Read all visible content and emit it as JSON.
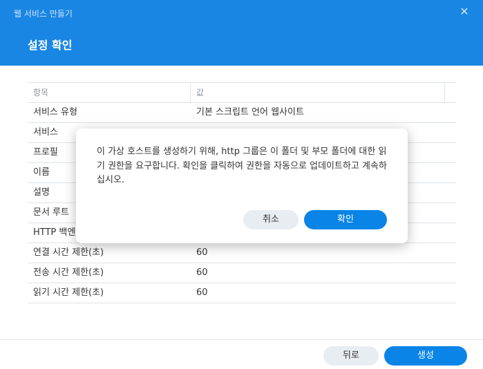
{
  "window": {
    "title": "웹 서비스 만들기",
    "close_icon": "✕",
    "page_title": "설정 확인"
  },
  "table": {
    "headers": [
      "항목",
      "값"
    ],
    "rows": [
      {
        "item": "서비스 유형",
        "value": "기본 스크립트 언어 웹사이트"
      },
      {
        "item": "서비스",
        "value": ""
      },
      {
        "item": "프로필",
        "value": ""
      },
      {
        "item": "이름",
        "value": ""
      },
      {
        "item": "설명",
        "value": ""
      },
      {
        "item": "문서 루트",
        "value": ""
      },
      {
        "item": "HTTP 백엔드",
        "value": ""
      },
      {
        "item": "연결 시간 제한(초)",
        "value": "60"
      },
      {
        "item": "전송 시간 제한(초)",
        "value": "60"
      },
      {
        "item": "읽기 시간 제한(초)",
        "value": "60"
      }
    ]
  },
  "footer": {
    "back_label": "뒤로",
    "create_label": "생성"
  },
  "dialog": {
    "message": "이 가상 호스트를 생성하기 위해, http 그룹은 이 폴더 및 부모 폴더에 대한 읽기 권한을 요구합니다. 확인을 클릭하여 권한을 자동으로 업데이트하고 계속하십시오.",
    "cancel_label": "취소",
    "ok_label": "확인"
  },
  "colors": {
    "header": "#1a86e3",
    "primary_button": "#0a84e6",
    "secondary_button": "#e8edf2"
  }
}
